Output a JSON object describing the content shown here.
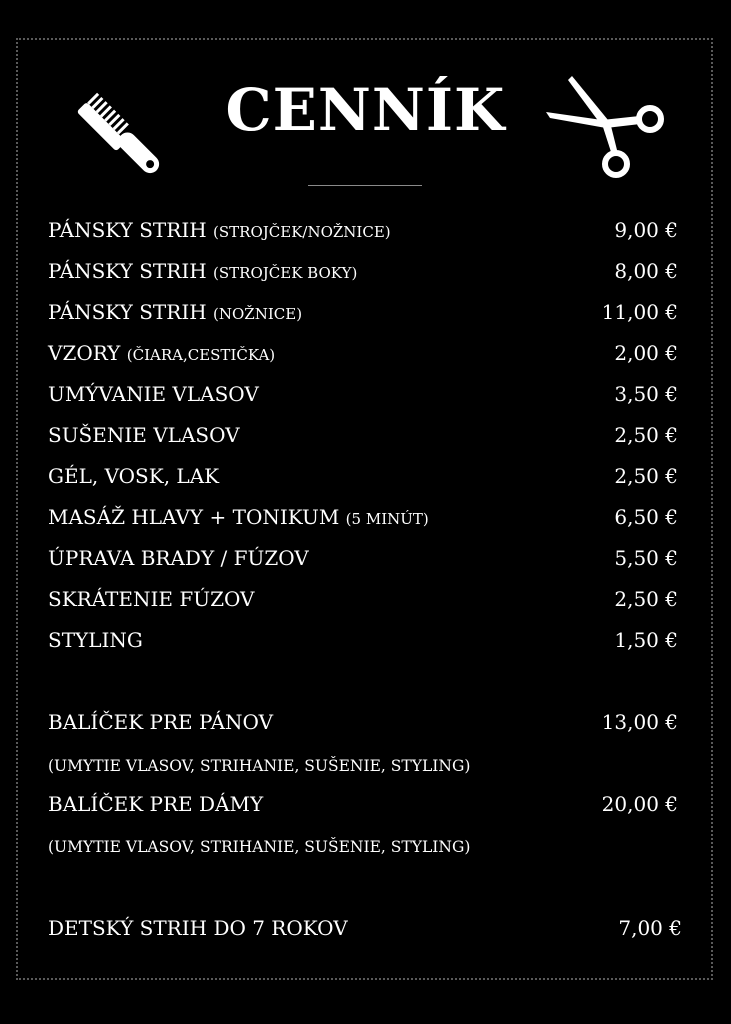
{
  "header": {
    "title": "CENNÍK",
    "left_icon": "comb-icon",
    "right_icon": "scissors-icon"
  },
  "services": [
    {
      "name": "PÁNSKY STRIH",
      "note": "(STROJČEK/NOŽNICE)",
      "price": "9,00 €"
    },
    {
      "name": "PÁNSKY STRIH",
      "note": "(STROJČEK BOKY)",
      "price": "8,00 €"
    },
    {
      "name": "PÁNSKY STRIH",
      "note": "(NOŽNICE)",
      "price": "11,00 €"
    },
    {
      "name": "VZORY",
      "note": "(ČIARA,CESTIČKA)",
      "price": "2,00 €"
    },
    {
      "name": "UMÝVANIE VLASOV",
      "note": "",
      "price": "3,50 €"
    },
    {
      "name": "SUŠENIE VLASOV",
      "note": "",
      "price": "2,50 €"
    },
    {
      "name": "GÉL, VOSK, LAK",
      "note": "",
      "price": "2,50 €"
    },
    {
      "name": "MASÁŽ HLAVY + TONIKUM",
      "note": "(5 MINÚT)",
      "price": "6,50 €"
    },
    {
      "name": "ÚPRAVA BRADY / FÚZOV",
      "note": "",
      "price": "5,50 €"
    },
    {
      "name": "SKRÁTENIE FÚZOV",
      "note": "",
      "price": "2,50 €"
    },
    {
      "name": "STYLING",
      "note": "",
      "price": "1,50 €"
    }
  ],
  "packages": [
    {
      "name": "BALÍČEK PRE PÁNOV",
      "price": "13,00 €",
      "details": "(UMYTIE VLASOV, STRIHANIE, SUŠENIE, STYLING)"
    },
    {
      "name": "BALÍČEK PRE DÁMY",
      "price": "20,00 €",
      "details": "(UMYTIE VLASOV, STRIHANIE, SUŠENIE, STYLING)"
    }
  ],
  "kids": {
    "name": "DETSKÝ STRIH DO 7 ROKOV",
    "price": "7,00 €"
  },
  "colors": {
    "background": "#000000",
    "text": "#ffffff",
    "frame": "#5a5a5a"
  }
}
